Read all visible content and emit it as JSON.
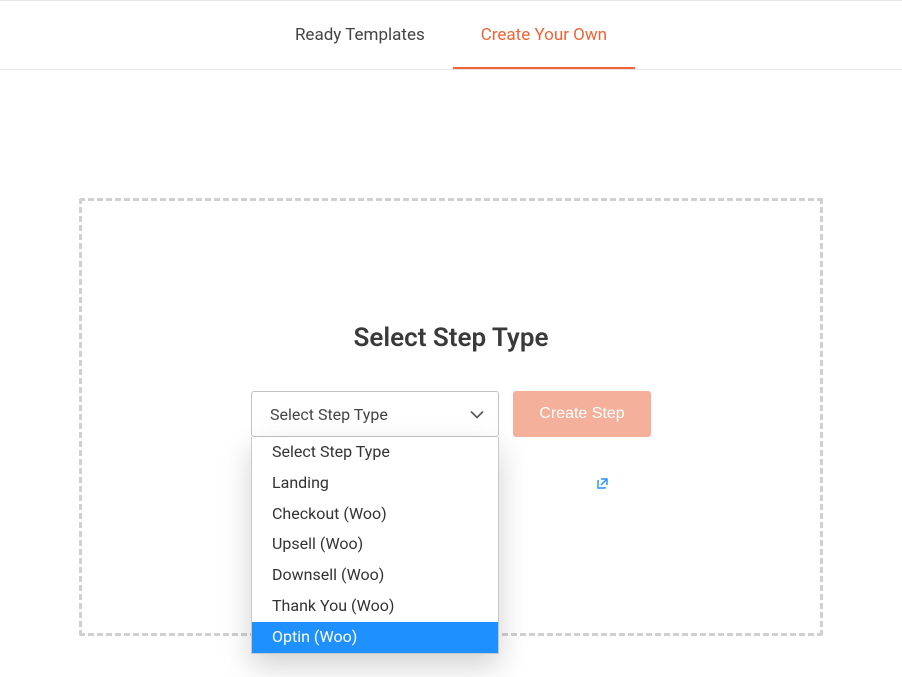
{
  "tabs": {
    "ready_templates": "Ready Templates",
    "create_your_own": "Create Your Own"
  },
  "main": {
    "heading": "Select Step Type",
    "select": {
      "placeholder": "Select Step Type",
      "options": [
        "Select Step Type",
        "Landing",
        "Checkout (Woo)",
        "Upsell (Woo)",
        "Downsell (Woo)",
        "Thank You (Woo)",
        "Optin (Woo)"
      ],
      "highlighted_index": 6
    },
    "create_button": "Create Step"
  }
}
